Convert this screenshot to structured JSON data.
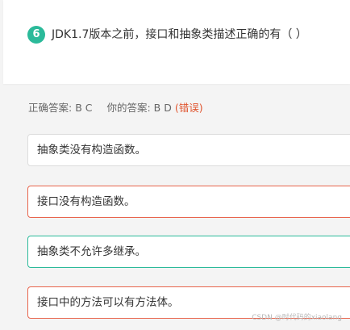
{
  "question": {
    "number": "6",
    "text": "JDK1.7版本之前，接口和抽象类描述正确的有（ ）"
  },
  "answers": {
    "correct_label": "正确答案:",
    "correct_value": "B C",
    "yours_label": "你的答案:",
    "yours_value": "B D",
    "status": "(错误)"
  },
  "options": [
    {
      "text": "抽象类没有构造函数。",
      "state": "normal"
    },
    {
      "text": "接口没有构造函数。",
      "state": "selected-correct"
    },
    {
      "text": "抽象类不允许多继承。",
      "state": "correct"
    },
    {
      "text": "接口中的方法可以有方法体。",
      "state": "selected-wrong"
    }
  ],
  "watermark": "CSDN @时代码的xiaolang",
  "colors": {
    "accent": "#2bba9a",
    "error": "#e0552f",
    "option_wrong_border": "#e8644c"
  }
}
